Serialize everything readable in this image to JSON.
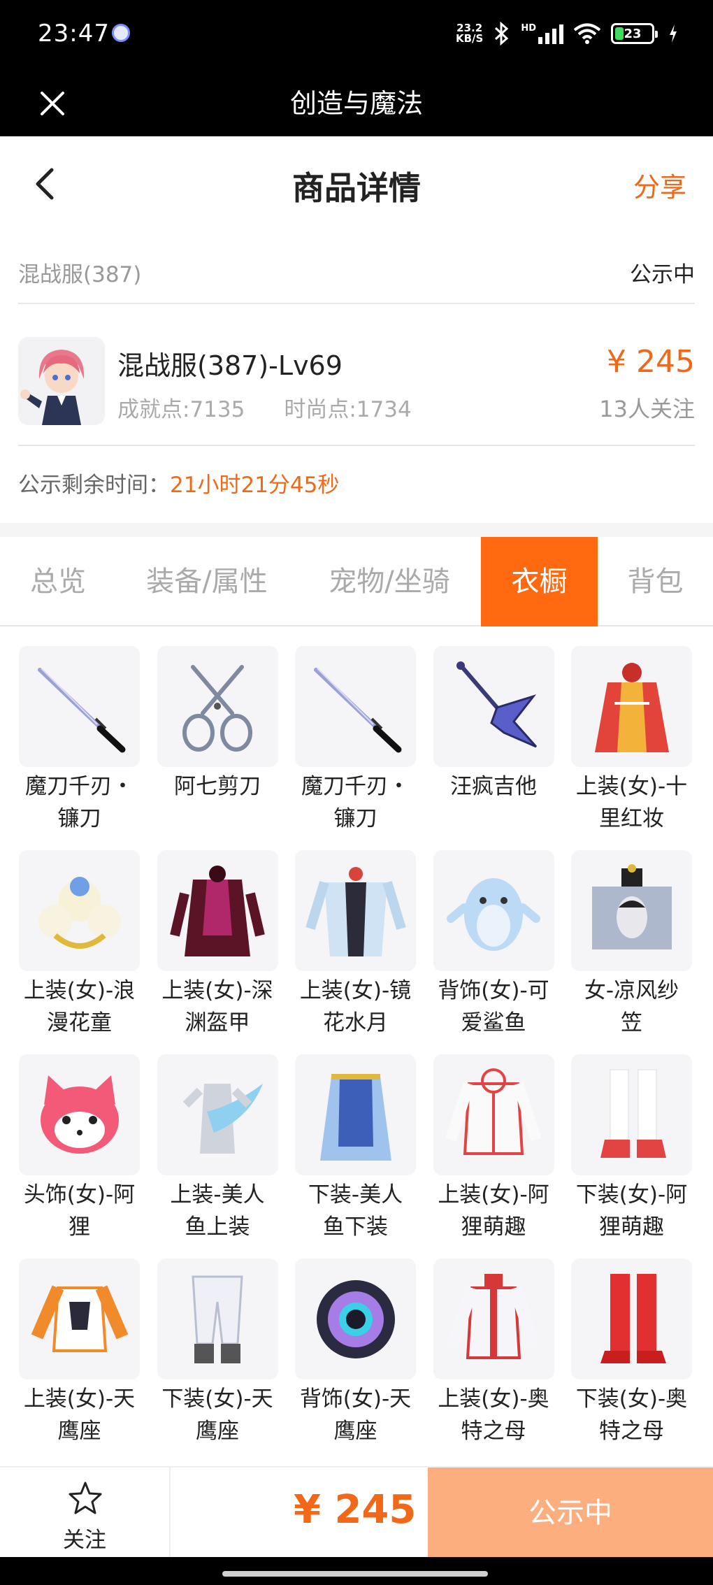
{
  "status_bar": {
    "time": "23:47",
    "net_speed_value": "23.2",
    "net_speed_unit": "KB/S",
    "network_label": "HD",
    "battery": "23",
    "battery_fraction": 0.23
  },
  "title_bar": {
    "title": "创造与魔法"
  },
  "page_header": {
    "title": "商品详情",
    "share_label": "分享"
  },
  "listing": {
    "server": "混战服(387)",
    "status": "公示中",
    "item_name": "混战服(387)-Lv69",
    "achievement": "成就点:7135",
    "fashion": "时尚点:1734",
    "price": "¥ 245",
    "watchers": "13人关注",
    "remaining_label": "公示剩余时间：",
    "remaining_value": "21小时21分45秒"
  },
  "tabs": [
    {
      "label": "总览",
      "active": false
    },
    {
      "label": "装备/属性",
      "active": false
    },
    {
      "label": "宠物/坐骑",
      "active": false
    },
    {
      "label": "衣橱",
      "active": true
    },
    {
      "label": "背包",
      "active": false
    }
  ],
  "wardrobe": [
    {
      "line1": "魔刀千刃・",
      "line2": "镰刀",
      "icon": "katana-icon"
    },
    {
      "line1": "阿七剪刀",
      "line2": "",
      "icon": "scissors-icon"
    },
    {
      "line1": "魔刀千刃・",
      "line2": "镰刀",
      "icon": "katana-icon"
    },
    {
      "line1": "汪疯吉他",
      "line2": "",
      "icon": "guitar-icon"
    },
    {
      "line1": "上装(女)-十",
      "line2": "里红妆",
      "icon": "red-robe-icon"
    },
    {
      "line1": "上装(女)-浪",
      "line2": "漫花童",
      "icon": "flower-dress-icon"
    },
    {
      "line1": "上装(女)-深",
      "line2": "渊盔甲",
      "icon": "dark-armor-icon"
    },
    {
      "line1": "上装(女)-镜",
      "line2": "花水月",
      "icon": "kimono-icon"
    },
    {
      "line1": "背饰(女)-可",
      "line2": "爱鲨鱼",
      "icon": "shark-icon"
    },
    {
      "line1": "女-凉风纱",
      "line2": "笠",
      "icon": "veil-hat-icon"
    },
    {
      "line1": "头饰(女)-阿",
      "line2": "狸",
      "icon": "fox-head-icon"
    },
    {
      "line1": "上装-美人",
      "line2": "鱼上装",
      "icon": "mermaid-top-icon"
    },
    {
      "line1": "下装-美人",
      "line2": "鱼下装",
      "icon": "mermaid-skirt-icon"
    },
    {
      "line1": "上装(女)-阿",
      "line2": "狸萌趣",
      "icon": "hoodie-icon"
    },
    {
      "line1": "下装(女)-阿",
      "line2": "狸萌趣",
      "icon": "boots-icon"
    },
    {
      "line1": "上装(女)-天",
      "line2": "鹰座",
      "icon": "orange-jacket-icon"
    },
    {
      "line1": "下装(女)-天",
      "line2": "鹰座",
      "icon": "white-pants-icon"
    },
    {
      "line1": "背饰(女)-天",
      "line2": "鹰座",
      "icon": "star-backpack-icon"
    },
    {
      "line1": "上装(女)-奥",
      "line2": "特之母",
      "icon": "red-white-top-icon"
    },
    {
      "line1": "下装(女)-奥",
      "line2": "特之母",
      "icon": "red-boots-icon"
    }
  ],
  "bottom_bar": {
    "follow_label": "关注",
    "price": "¥ 245",
    "status_label": "公示中"
  },
  "colors": {
    "accent": "#f06818",
    "tab_active": "#ff6a10",
    "status_button": "#fcae7f"
  }
}
